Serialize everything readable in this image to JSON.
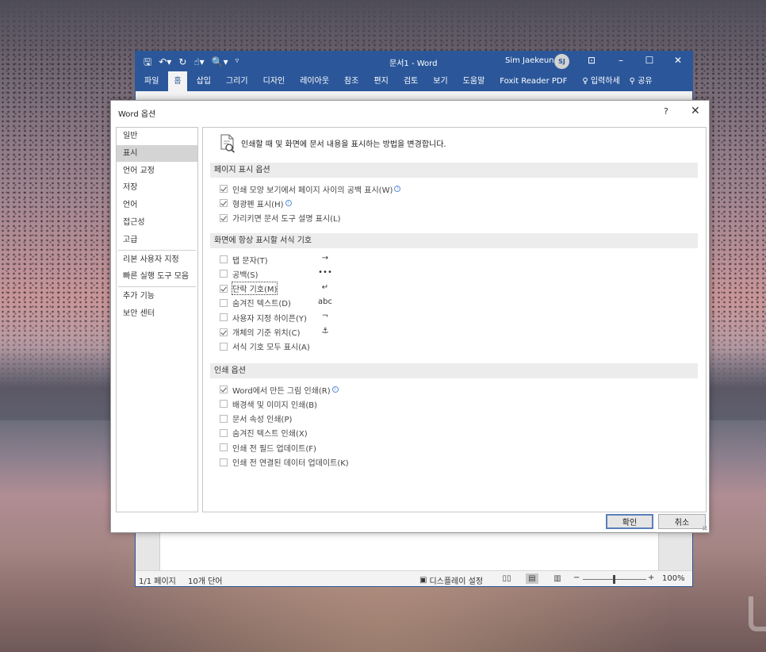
{
  "word": {
    "doc_title": "문서1 - Word",
    "user_name": "Sim Jaekeun",
    "user_initials": "SJ",
    "qat_icons": [
      "save-icon",
      "undo-icon",
      "redo-icon",
      "touch-mode-icon",
      "print-preview-icon",
      "customize-qat-icon"
    ],
    "tabs": [
      "파일",
      "홈",
      "삽입",
      "그리기",
      "디자인",
      "레이아웃",
      "참조",
      "편지",
      "검토",
      "보기",
      "도움말",
      "Foxit Reader PDF"
    ],
    "active_tab": "홈",
    "tell_me": "입력하세",
    "share": "공유",
    "status": {
      "pages": "1/1 페이지",
      "words": "10개 단어",
      "display_settings": "디스플레이 설정",
      "zoom_minus": "−",
      "zoom_plus": "+",
      "zoom_level": "100%",
      "zoom_fraction": 0.5
    }
  },
  "dialog": {
    "title": "Word 옵션",
    "help": "?",
    "close": "✕",
    "nav": [
      "일반",
      "표시",
      "언어 교정",
      "저장",
      "언어",
      "접근성",
      "고급",
      "리본 사용자 지정",
      "빠른 실행 도구 모음",
      "추가 기능",
      "보안 센터"
    ],
    "selected_nav": "표시",
    "header": "인쇄할 때 및 화면에 문서 내용을 표시하는 방법을 변경합니다.",
    "sections": [
      {
        "title": "페이지 표시 옵션",
        "options": [
          {
            "label": "인쇄 모양 보기에서 페이지 사이의 공백 표시(W)",
            "checked": true,
            "info": true
          },
          {
            "label": "형광펜 표시(H)",
            "checked": true,
            "info": true
          },
          {
            "label": "가리키면 문서 도구 설명 표시(L)",
            "checked": true,
            "info": false
          }
        ]
      },
      {
        "title": "화면에 항상 표시할 서식 기호",
        "options": [
          {
            "label": "탭 문자(T)",
            "checked": false,
            "symbol": "→"
          },
          {
            "label": "공백(S)",
            "checked": false,
            "symbol": "•••"
          },
          {
            "label": "단락 기호(M)",
            "checked": true,
            "symbol": "↵",
            "focused": true
          },
          {
            "label": "숨겨진 텍스트(D)",
            "checked": false,
            "symbol": "abc"
          },
          {
            "label": "사용자 지정 하이픈(Y)",
            "checked": false,
            "symbol": "¬"
          },
          {
            "label": "개체의 기준 위치(C)",
            "checked": true,
            "symbol": "⚓"
          },
          {
            "label": "서식 기호 모두 표시(A)",
            "checked": false,
            "symbol": ""
          }
        ]
      },
      {
        "title": "인쇄 옵션",
        "options": [
          {
            "label": "Word에서 만든 그림 인쇄(R)",
            "checked": true,
            "info": true
          },
          {
            "label": "배경색 및 이미지 인쇄(B)",
            "checked": false
          },
          {
            "label": "문서 속성 인쇄(P)",
            "checked": false
          },
          {
            "label": "숨겨진 텍스트 인쇄(X)",
            "checked": false
          },
          {
            "label": "인쇄 전 필드 업데이트(F)",
            "checked": false
          },
          {
            "label": "인쇄 전 연결된 데이터 업데이트(K)",
            "checked": false
          }
        ]
      }
    ],
    "ok_label": "확인",
    "cancel_label": "취소"
  },
  "colors": {
    "word_blue": "#2b579a",
    "nav_selected": "#d4d4d4",
    "section_bg": "#ececec"
  }
}
